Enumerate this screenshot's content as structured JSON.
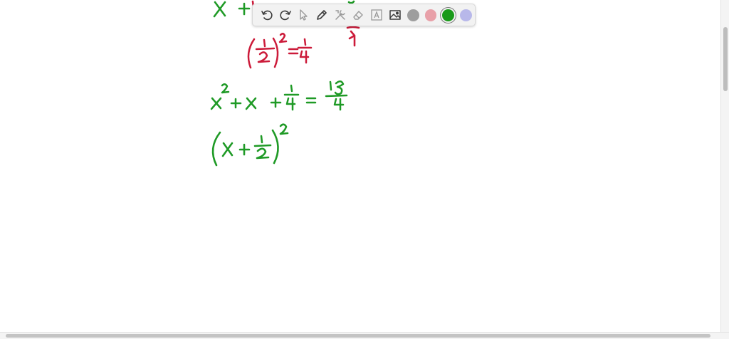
{
  "toolbar": {
    "tools": [
      {
        "icon": "undo-icon"
      },
      {
        "icon": "redo-icon"
      },
      {
        "icon": "select-pointer-icon"
      },
      {
        "icon": "pen-icon"
      },
      {
        "icon": "tools-icon"
      },
      {
        "icon": "eraser-icon"
      },
      {
        "icon": "text-box-icon"
      },
      {
        "icon": "image-icon"
      }
    ],
    "colors": [
      "#9e9e9e",
      "#e8a0a8",
      "#1a9a1a",
      "#b8b8ea"
    ],
    "selected_color": "#1a9a1a"
  },
  "ink": {
    "green": "#1f9a26",
    "red": "#cc1b3a"
  }
}
